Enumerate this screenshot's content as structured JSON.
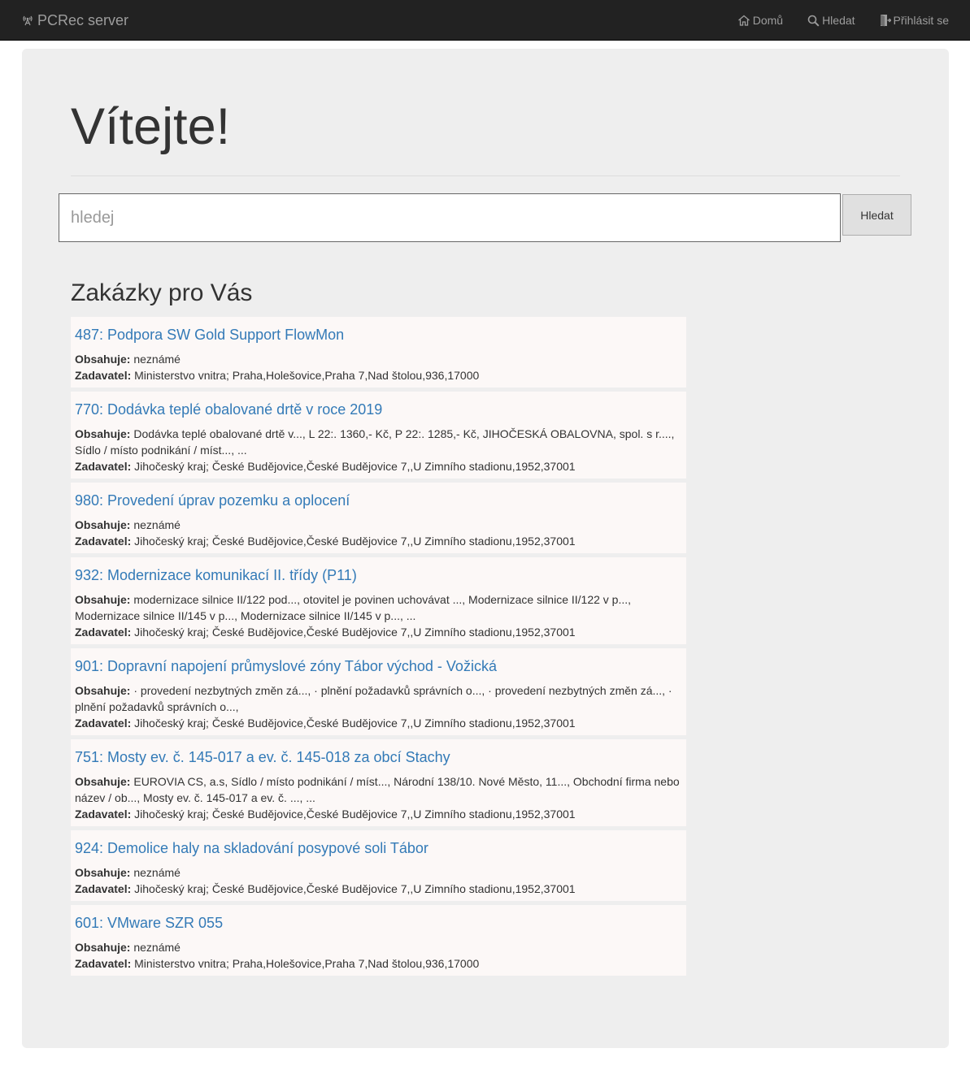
{
  "navbar": {
    "brand": "PCRec server",
    "brand_icon": "broadcast-tower-icon",
    "links": [
      {
        "label": "Domů",
        "icon": "home-icon"
      },
      {
        "label": "Hledat",
        "icon": "search-icon"
      },
      {
        "label": "Přihlásit se",
        "icon": "login-icon"
      }
    ]
  },
  "hero": {
    "title": "Vítejte!"
  },
  "search": {
    "placeholder": "hledej",
    "value": "",
    "button_label": "Hledat"
  },
  "section": {
    "title": "Zakázky pro Vás"
  },
  "labels": {
    "contains": "Obsahuje:",
    "contracting": "Zadavatel:"
  },
  "tenders": [
    {
      "title": "487: Podpora SW Gold Support FlowMon",
      "contains": "neznámé",
      "contracting": "Ministerstvo vnitra; Praha,Holešovice,Praha 7,Nad štolou,936,17000"
    },
    {
      "title": "770: Dodávka teplé obalované drtě v roce 2019",
      "contains": "Dodávka teplé obalované drtě v..., L 22:. 1360,- Kč, P 22:. 1285,- Kč, JIHOČESKÁ OBALOVNA, spol. s r...., Sídlo / místo podnikání / míst..., ...",
      "contracting": "Jihočeský kraj; České Budějovice,České Budějovice 7,,U Zimního stadionu,1952,37001"
    },
    {
      "title": "980: Provedení úprav pozemku a oplocení",
      "contains": "neznámé",
      "contracting": "Jihočeský kraj; České Budějovice,České Budějovice 7,,U Zimního stadionu,1952,37001"
    },
    {
      "title": "932: Modernizace komunikací II. třídy (P11)",
      "contains": "modernizace silnice II/122 pod..., otovitel je povinen uchovávat ..., Modernizace silnice II/122 v p..., Modernizace silnice II/145 v p..., Modernizace silnice II/145 v p..., ...",
      "contracting": "Jihočeský kraj; České Budějovice,České Budějovice 7,,U Zimního stadionu,1952,37001"
    },
    {
      "title": "901: Dopravní napojení průmyslové zóny Tábor východ - Vožická",
      "contains": "· provedení nezbytných změn zá..., · plnění požadavků správních o..., · provedení nezbytných změn zá..., · plnění požadavků správních o...,",
      "contracting": "Jihočeský kraj; České Budějovice,České Budějovice 7,,U Zimního stadionu,1952,37001"
    },
    {
      "title": "751: Mosty ev. č. 145-017 a ev. č. 145-018 za obcí Stachy",
      "contains": "EUROVIA CS, a.s, Sídlo / místo podnikání / míst..., Národní 138/10. Nové Město, 11..., Obchodní firma nebo název / ob..., Mosty ev. č. 145-017 a ev. č. ..., ...",
      "contracting": "Jihočeský kraj; České Budějovice,České Budějovice 7,,U Zimního stadionu,1952,37001"
    },
    {
      "title": "924: Demolice haly na skladování posypové soli Tábor",
      "contains": "neznámé",
      "contracting": "Jihočeský kraj; České Budějovice,České Budějovice 7,,U Zimního stadionu,1952,37001"
    },
    {
      "title": "601: VMware SZR 055",
      "contains": "neznámé",
      "contracting": "Ministerstvo vnitra; Praha,Holešovice,Praha 7,Nad štolou,936,17000"
    }
  ]
}
